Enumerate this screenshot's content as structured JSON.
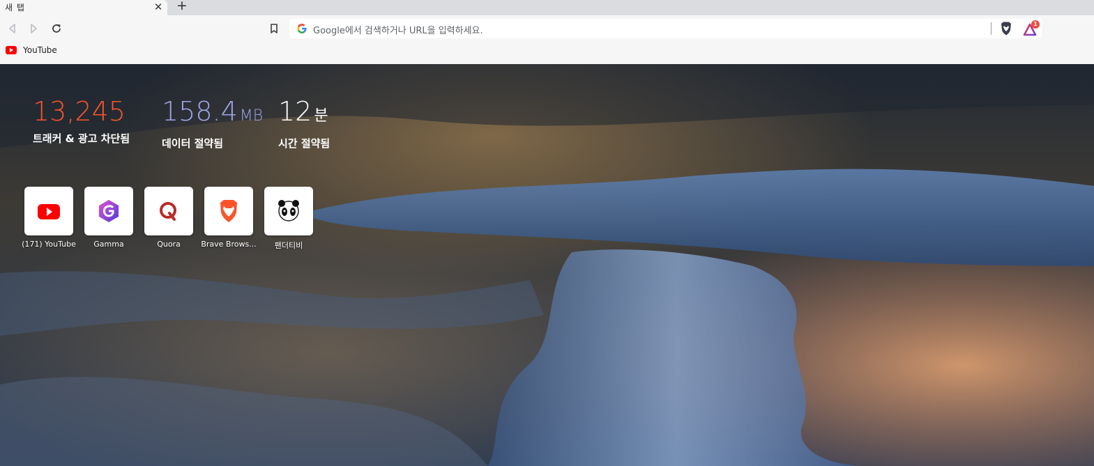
{
  "tab": {
    "title": "새 탭",
    "close_glyph": "✕",
    "new_tab_glyph": "+"
  },
  "toolbar": {
    "icons": [
      "back-icon",
      "forward-icon",
      "reload-icon",
      "bookmark-icon",
      "google-icon",
      "brave-shields-icon",
      "brave-rewards-icon"
    ],
    "omnibox_placeholder": "Google에서 검색하거나 URL을 입력하세요.",
    "rewards_badge": "1"
  },
  "bookmarks_bar": {
    "items": [
      {
        "label": "YouTube",
        "icon": "youtube-icon"
      }
    ]
  },
  "stats": {
    "trackers": {
      "value": "13,245",
      "label": "트래커 & 광고 차단됨",
      "color": "#fb542b"
    },
    "data": {
      "value": "158.4",
      "unit": "MB",
      "label": "데이터 절약됨",
      "color": "#a0a5eb"
    },
    "time": {
      "value": "12",
      "unit": "분",
      "label": "시간 절약됨",
      "color": "#ffffff"
    }
  },
  "top_sites": [
    {
      "label": "(171) YouTube",
      "icon": "youtube-icon"
    },
    {
      "label": "Gamma",
      "icon": "gamma-icon"
    },
    {
      "label": "Quora",
      "icon": "quora-icon"
    },
    {
      "label": "Brave Brows...",
      "icon": "brave-lion-icon"
    },
    {
      "label": "팬더티비",
      "icon": "panda-icon"
    }
  ]
}
